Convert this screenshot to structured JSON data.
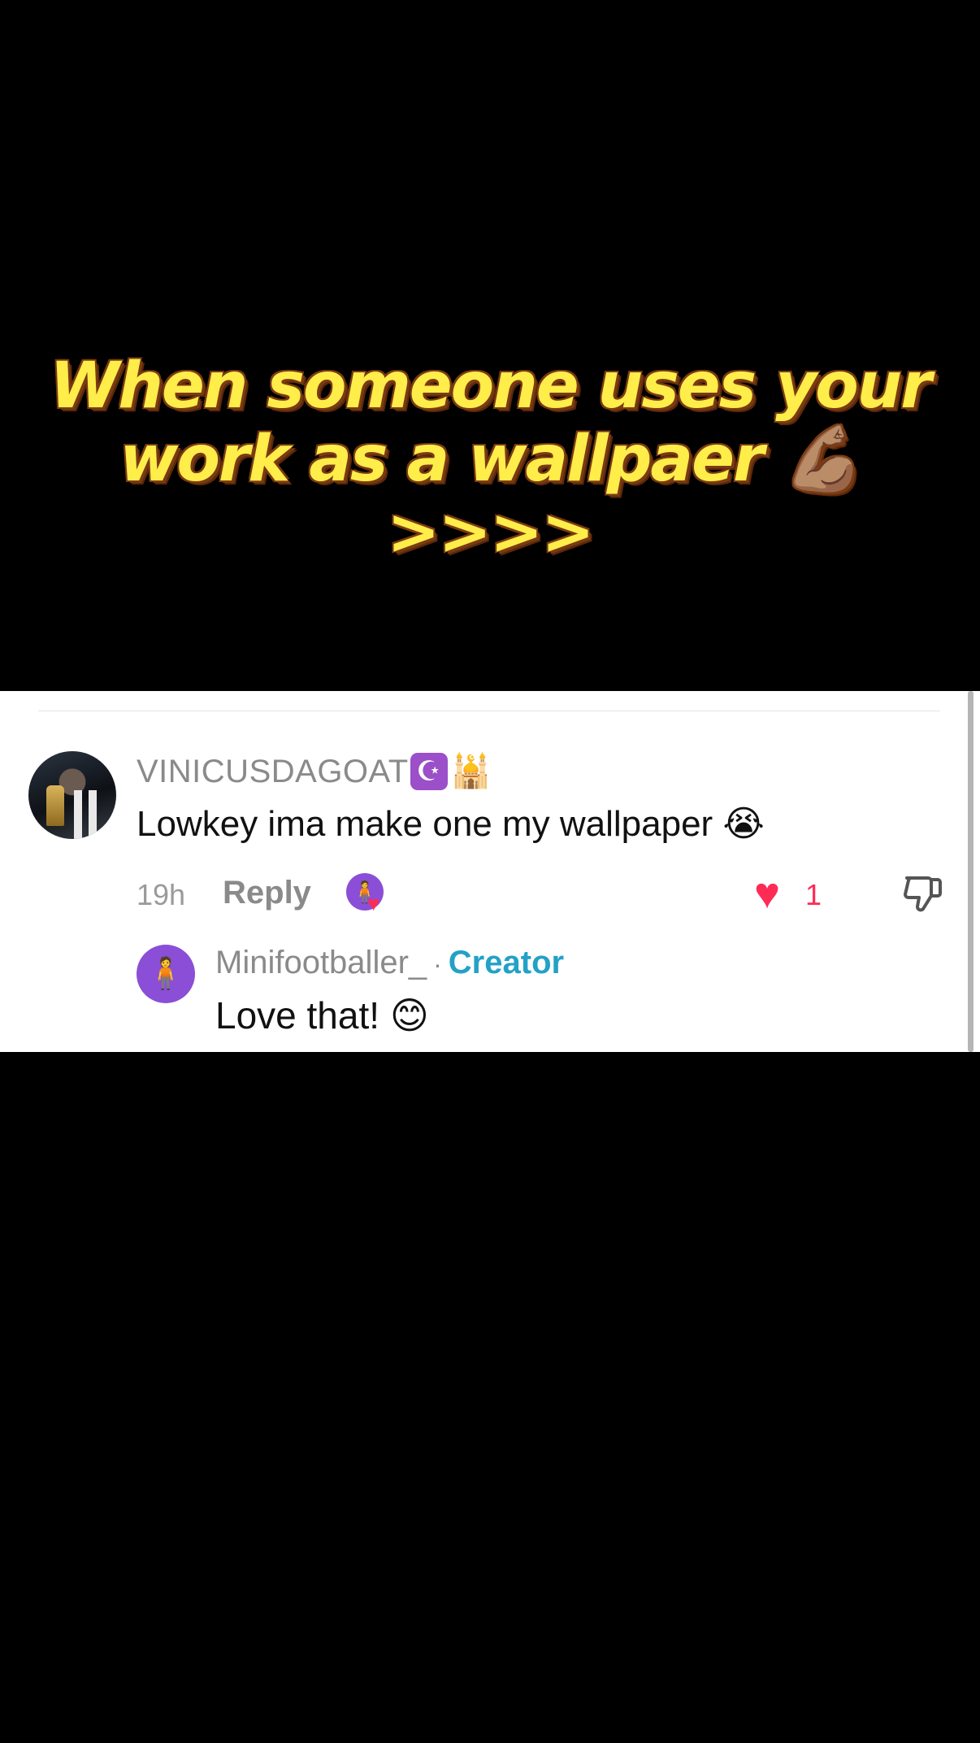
{
  "caption": {
    "line1": "When someone uses your",
    "line2": "work as a wallpaer 💪🏽",
    "line3": ">>>>"
  },
  "comment": {
    "username": "VINICUSDAGOAT",
    "badge_moon": "☪",
    "badge_mosque": "🕌",
    "text": "Lowkey ima make one my wallpaper 😭",
    "time": "19h",
    "reply_label": "Reply",
    "like_count": "1",
    "liked_by_creator_icon": "creator-heart-avatar",
    "like_icon": "heart-icon",
    "dislike_icon": "thumbs-down-icon"
  },
  "reply": {
    "username": "Minifootballer_",
    "separator": "·",
    "creator_label": "Creator",
    "text": "Love that! 😊"
  },
  "colors": {
    "background": "#000000",
    "caption_fill": "#ffed4a",
    "caption_outline": "#7a3a12",
    "like_red": "#fe2c55",
    "creator_blue": "#23a1c7",
    "muted_gray": "#8a8a8a"
  }
}
